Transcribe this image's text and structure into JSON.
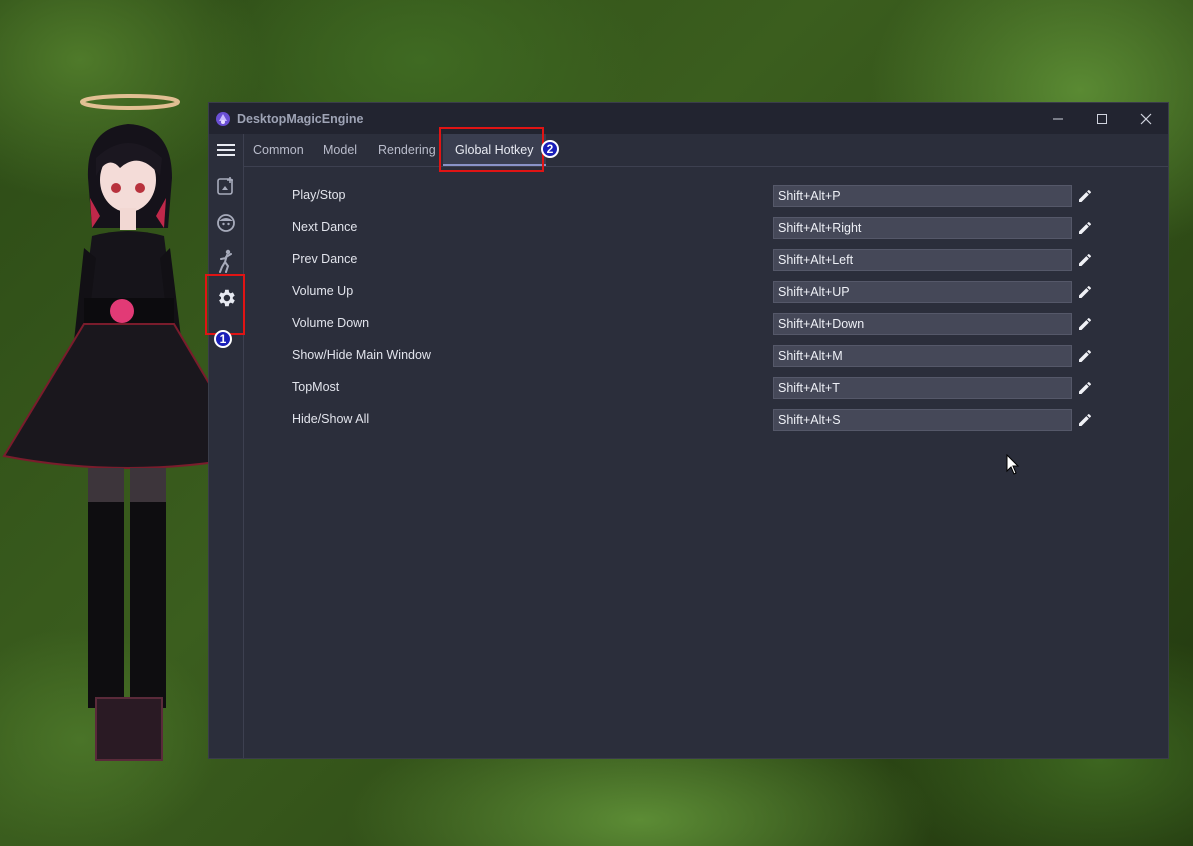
{
  "window": {
    "title": "DesktopMagicEngine"
  },
  "tabs": [
    {
      "label": "Common"
    },
    {
      "label": "Model"
    },
    {
      "label": "Rendering"
    },
    {
      "label": "Global Hotkey"
    }
  ],
  "active_tab": "Global Hotkey",
  "sidebar": {
    "items": [
      {
        "icon": "menu-icon"
      },
      {
        "icon": "add-image-icon"
      },
      {
        "icon": "face-icon"
      },
      {
        "icon": "dance-icon"
      },
      {
        "icon": "gear-icon"
      }
    ]
  },
  "hotkeys": [
    {
      "label": "Play/Stop",
      "value": "Shift+Alt+P"
    },
    {
      "label": "Next Dance",
      "value": "Shift+Alt+Right"
    },
    {
      "label": "Prev Dance",
      "value": "Shift+Alt+Left"
    },
    {
      "label": "Volume Up",
      "value": "Shift+Alt+UP"
    },
    {
      "label": "Volume Down",
      "value": "Shift+Alt+Down"
    },
    {
      "label": "Show/Hide Main Window",
      "value": "Shift+Alt+M"
    },
    {
      "label": "TopMost",
      "value": "Shift+Alt+T"
    },
    {
      "label": "Hide/Show All",
      "value": "Shift+Alt+S"
    }
  ],
  "annotations": [
    {
      "number": "1"
    },
    {
      "number": "2"
    }
  ],
  "colors": {
    "annotation_box": "#e01414",
    "annotation_badge": "#1a1fb8",
    "window_bg": "#2b2e3b",
    "input_bg": "#454858"
  }
}
